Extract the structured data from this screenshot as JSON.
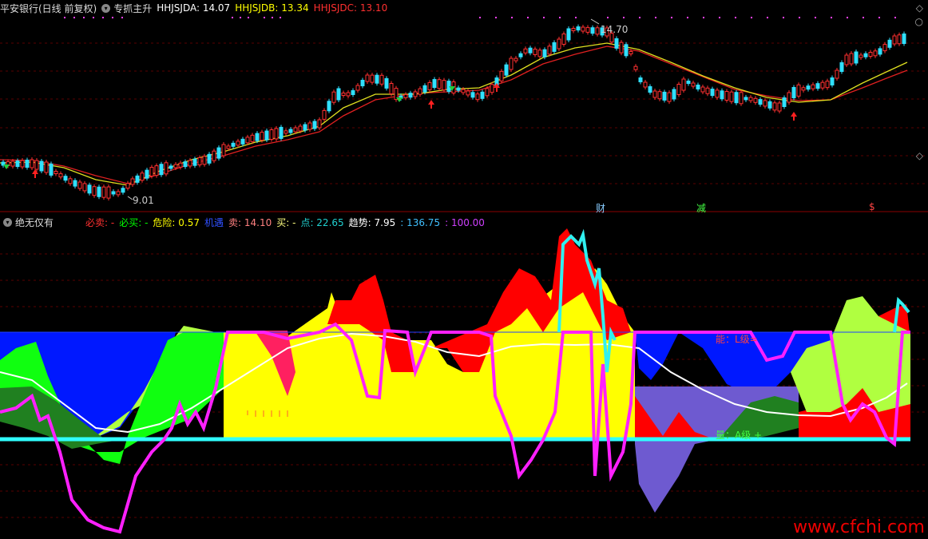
{
  "header": {
    "title": "平安银行(日线 前复权)",
    "indicator_name": "专抓主升",
    "items": [
      {
        "label": "HHJSJDA: 14.07",
        "color": "#ffffff"
      },
      {
        "label": "HHJSJDB: 13.34",
        "color": "#ffff00"
      },
      {
        "label": "HHJSJDC: 13.10",
        "color": "#ff3030"
      }
    ]
  },
  "price_chart": {
    "high_label": "14.70",
    "low_label": "9.01",
    "markers": {
      "cai": "财",
      "jian": "减",
      "s": "$"
    }
  },
  "sub_header": {
    "title": "绝无仅有",
    "items": [
      {
        "label": "必卖: -",
        "color": "#ff3030"
      },
      {
        "label": "必买: -",
        "color": "#00ff00"
      },
      {
        "label": "危险: 0.57",
        "color": "#ffff00"
      },
      {
        "label": "机遇",
        "color": "#3050ff"
      },
      {
        "label": "卖: 14.10",
        "color": "#ff8080"
      },
      {
        "label": "买: -",
        "color": "#ffff80"
      },
      {
        "label": "点: 22.65",
        "color": "#20d0d0"
      },
      {
        "label": "趋势: 7.95",
        "color": "#ffffff"
      },
      {
        "label": ": 136.75",
        "color": "#40c0ff"
      },
      {
        "label": ": 100.00",
        "color": "#d040ff"
      }
    ]
  },
  "sub_chart": {
    "label_top": "能：L级=",
    "label_bottom": "量：A级 +"
  },
  "watermark": "www.cfchi.com"
}
